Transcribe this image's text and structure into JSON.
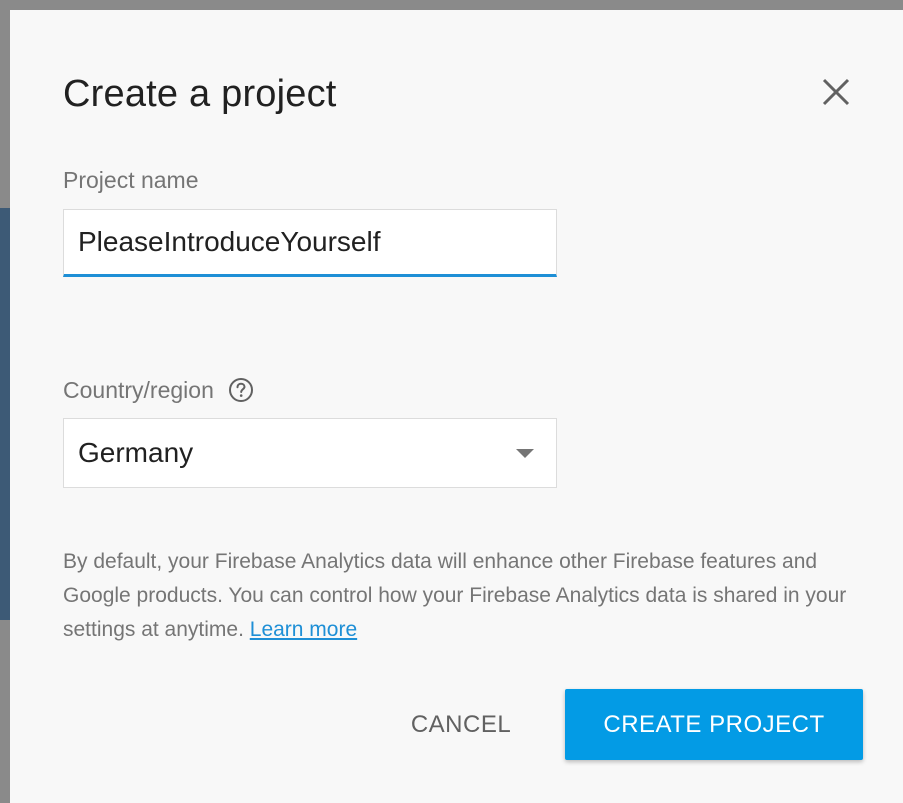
{
  "dialog": {
    "title": "Create a project",
    "close_icon": "close-icon"
  },
  "project_name": {
    "label": "Project name",
    "value": "PleaseIntroduceYourself"
  },
  "country_region": {
    "label": "Country/region",
    "help_icon": "help-circle-icon",
    "selected": "Germany",
    "dropdown_icon": "dropdown-arrow-icon"
  },
  "info": {
    "text": "By default, your Firebase Analytics data will enhance other Firebase features and Google products. You can control how your Firebase Analytics data is shared in your settings at anytime. ",
    "link_label": "Learn more"
  },
  "actions": {
    "cancel_label": "CANCEL",
    "create_label": "CREATE PROJECT"
  },
  "colors": {
    "accent": "#1e8fd6",
    "primary_button": "#039be5",
    "text_primary": "#212121",
    "text_secondary": "#757575"
  }
}
